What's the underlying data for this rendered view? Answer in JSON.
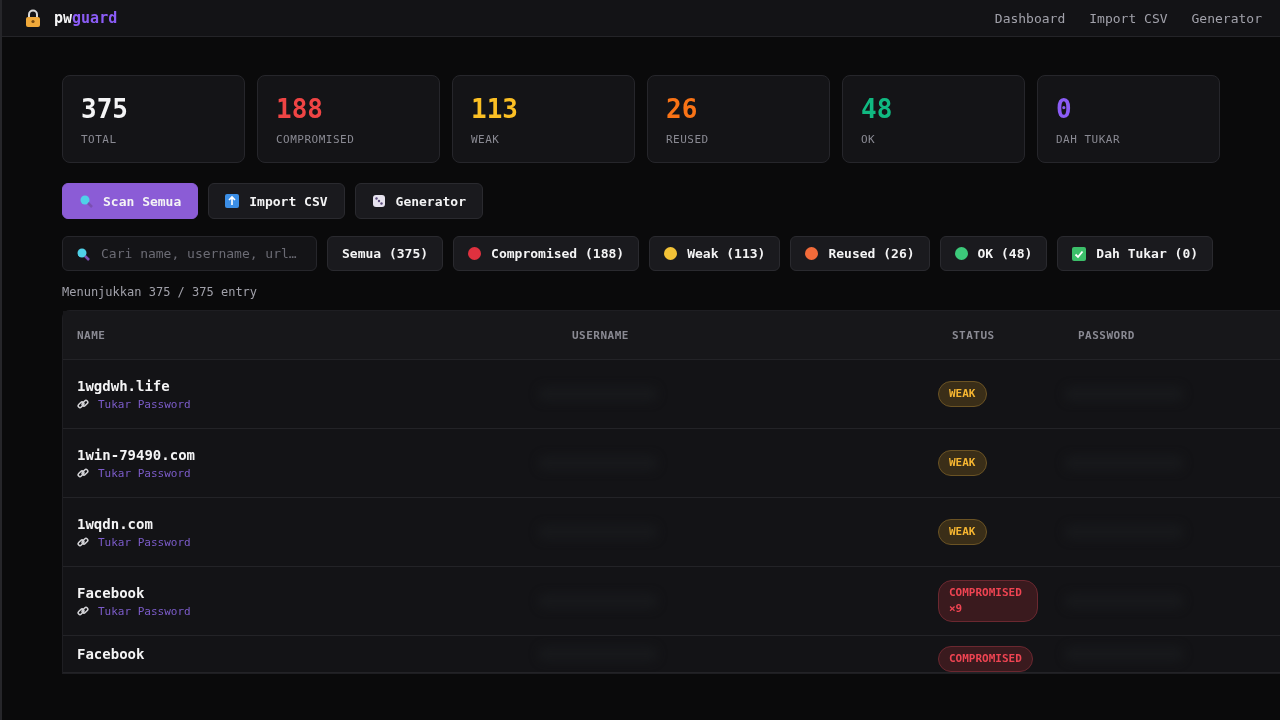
{
  "header": {
    "brand_prefix": "pw",
    "brand_accent": "guard",
    "nav": [
      "Dashboard",
      "Import CSV",
      "Generator"
    ]
  },
  "stats": [
    {
      "value": "375",
      "label": "TOTAL",
      "color": "#f4f4f5"
    },
    {
      "value": "188",
      "label": "COMPROMISED",
      "color": "#ef4444"
    },
    {
      "value": "113",
      "label": "WEAK",
      "color": "#fbbf24"
    },
    {
      "value": "26",
      "label": "REUSED",
      "color": "#f97316"
    },
    {
      "value": "48",
      "label": "OK",
      "color": "#10b981"
    },
    {
      "value": "0",
      "label": "DAH TUKAR",
      "color": "#8b5cf6"
    }
  ],
  "actions": [
    {
      "label": "Scan Semua",
      "kind": "scan",
      "primary": true
    },
    {
      "label": "Import CSV",
      "kind": "upload",
      "primary": false
    },
    {
      "label": "Generator",
      "kind": "dice",
      "primary": false
    }
  ],
  "search": {
    "placeholder": "Cari name, username, url…"
  },
  "filters": [
    {
      "label": "Semua (375)",
      "kind": "plain"
    },
    {
      "label": "Compromised (188)",
      "kind": "dot",
      "color": "#e0313f"
    },
    {
      "label": "Weak (113)",
      "kind": "dot",
      "color": "#f2c237"
    },
    {
      "label": "Reused (26)",
      "kind": "dot",
      "color": "#f26b3a"
    },
    {
      "label": "OK (48)",
      "kind": "dot",
      "color": "#3cc97a"
    },
    {
      "label": "Dah Tukar (0)",
      "kind": "check"
    }
  ],
  "summary": "Menunjukkan 375 / 375 entry",
  "table": {
    "columns": [
      "NAME",
      "USERNAME",
      "STATUS",
      "PASSWORD"
    ],
    "rows": [
      {
        "name": "1wgdwh.life",
        "link": "Tukar Password",
        "kind": "weak",
        "badge": "WEAK"
      },
      {
        "name": "1win-79490.com",
        "link": "Tukar Password",
        "kind": "weak",
        "badge": "WEAK"
      },
      {
        "name": "1wqdn.com",
        "link": "Tukar Password",
        "kind": "weak",
        "badge": "WEAK"
      },
      {
        "name": "Facebook",
        "link": "Tukar Password",
        "kind": "compromised",
        "badge": "COMPROMISED ×9"
      },
      {
        "name": "Facebook",
        "kind": "compromised",
        "badge": "COMPROMISED"
      }
    ]
  }
}
